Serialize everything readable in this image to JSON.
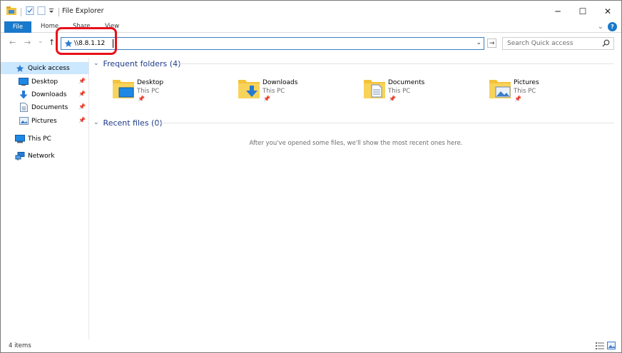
{
  "window": {
    "title": "File Explorer",
    "controls": {
      "minimize": "─",
      "maximize": "☐",
      "close": "✕"
    }
  },
  "ribbon": {
    "tabs": [
      {
        "label": "File"
      },
      {
        "label": "Home"
      },
      {
        "label": "Share"
      },
      {
        "label": "View"
      }
    ],
    "expand_glyph": "⌄",
    "help_glyph": "?"
  },
  "navigation": {
    "back_glyph": "←",
    "forward_glyph": "→",
    "recent_glyph": "⌄",
    "up_glyph": "↑",
    "address": {
      "value": "\\\\8.8.1.12",
      "dropdown_glyph": "⌄"
    },
    "go_glyph": "→",
    "search": {
      "placeholder": "Search Quick access"
    }
  },
  "sidebar": {
    "items": [
      {
        "label": "Quick access",
        "icon": "star-icon",
        "selected": true
      },
      {
        "label": "Desktop",
        "icon": "desktop-icon",
        "pinned": true
      },
      {
        "label": "Downloads",
        "icon": "download-arrow-icon",
        "pinned": true
      },
      {
        "label": "Documents",
        "icon": "document-icon",
        "pinned": true
      },
      {
        "label": "Pictures",
        "icon": "pictures-icon",
        "pinned": true
      },
      {
        "label": "This PC",
        "icon": "computer-icon"
      },
      {
        "label": "Network",
        "icon": "network-icon"
      }
    ],
    "pin_glyph": "📌"
  },
  "main": {
    "frequent": {
      "header": "Frequent folders (4)",
      "folders": [
        {
          "name": "Desktop",
          "location": "This PC",
          "icon": "desktop-folder-icon"
        },
        {
          "name": "Downloads",
          "location": "This PC",
          "icon": "downloads-folder-icon"
        },
        {
          "name": "Documents",
          "location": "This PC",
          "icon": "documents-folder-icon"
        },
        {
          "name": "Pictures",
          "location": "This PC",
          "icon": "pictures-folder-icon"
        }
      ]
    },
    "recent": {
      "header": "Recent files (0)",
      "empty_message": "After you've opened some files, we'll show the most recent ones here."
    },
    "chevron_glyph": "⌄"
  },
  "status": {
    "item_count": "4 items"
  },
  "colors": {
    "accent": "#1979ca",
    "selection": "#cce8ff",
    "highlight_ring": "#e8101a",
    "section_header": "#1e3b89"
  }
}
